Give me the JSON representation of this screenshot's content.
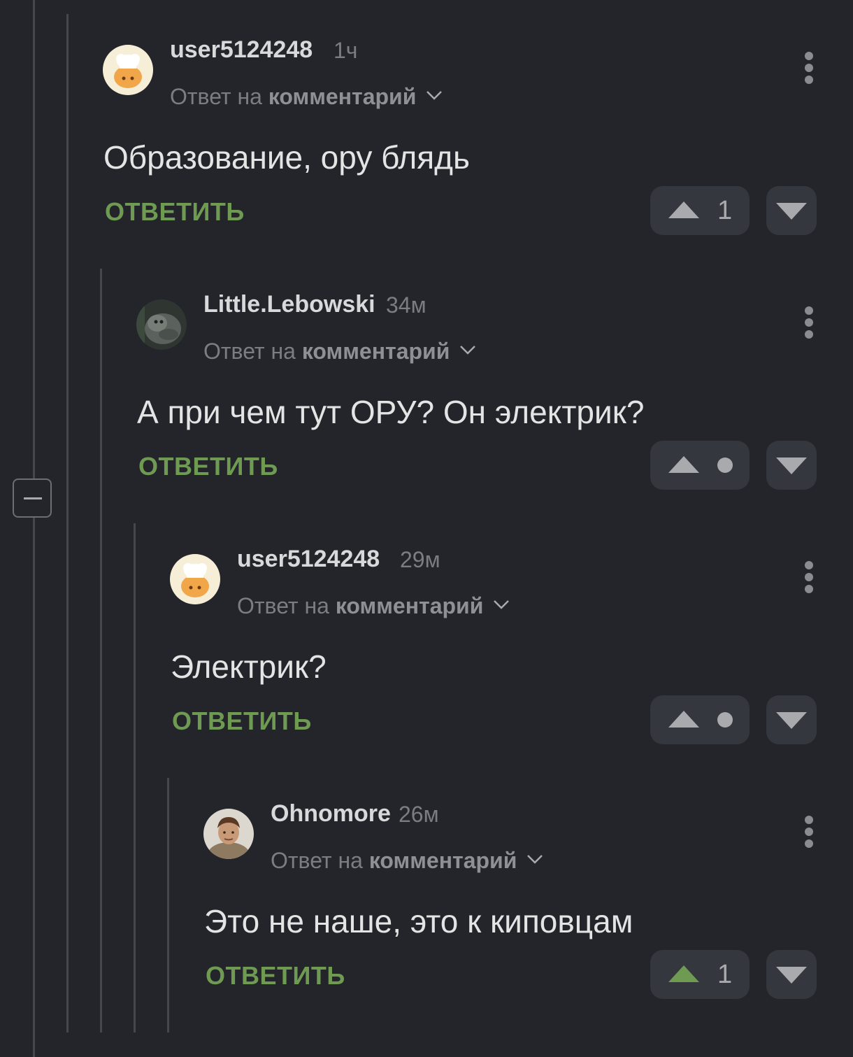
{
  "comments": [
    {
      "username": "user5124248",
      "time": "1ч",
      "reply_prefix": "Ответ на",
      "reply_target": "комментарий",
      "text": "Образование, ору блядь",
      "reply_label": "ОТВЕТИТЬ",
      "rating": "1",
      "upvoted": false,
      "avatar_icon": "chef-hat-avatar-icon"
    },
    {
      "username": "Little.Lebowski",
      "time": "34м",
      "reply_prefix": "Ответ на",
      "reply_target": "комментарий",
      "text": "А при чем тут ОРУ? Он электрик?",
      "reply_label": "ОТВЕТИТЬ",
      "rating": null,
      "upvoted": false,
      "avatar_icon": "animal-photo-avatar-icon"
    },
    {
      "username": "user5124248",
      "time": "29м",
      "reply_prefix": "Ответ на",
      "reply_target": "комментарий",
      "text": "Электрик?",
      "reply_label": "ОТВЕТИТЬ",
      "rating": null,
      "upvoted": false,
      "avatar_icon": "chef-hat-avatar-icon"
    },
    {
      "username": "Ohnomore",
      "time": "26м",
      "reply_prefix": "Ответ на",
      "reply_target": "комментарий",
      "text": "Это не наше, это к киповцам",
      "reply_label": "ОТВЕТИТЬ",
      "rating": "1",
      "upvoted": true,
      "avatar_icon": "person-photo-avatar-icon"
    }
  ],
  "colors": {
    "background": "#23252b",
    "accent_green": "#6f9a52",
    "button_bg": "#34373d",
    "muted_text": "#7a7d82"
  }
}
